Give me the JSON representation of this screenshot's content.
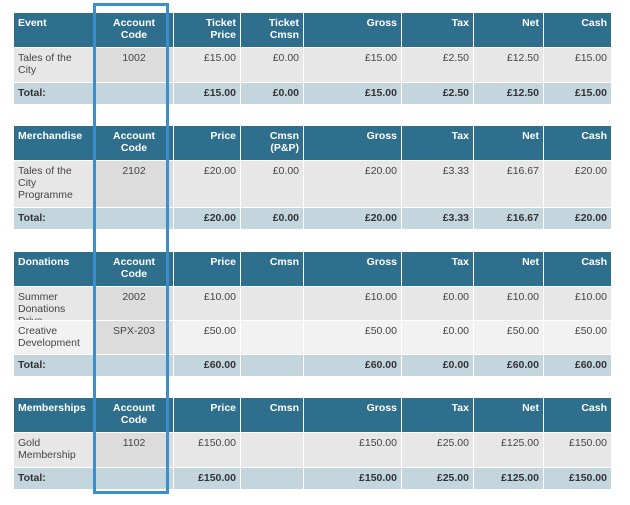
{
  "tables": [
    {
      "headers": [
        "Event",
        "Account Code",
        "Ticket Price",
        "Ticket Cmsn",
        "Gross",
        "Tax",
        "Net",
        "Cash"
      ],
      "rows": [
        [
          "Tales of the City",
          "1002",
          "£15.00",
          "£0.00",
          "£15.00",
          "£2.50",
          "£12.50",
          "£15.00"
        ]
      ],
      "total": [
        "Total:",
        "",
        "£15.00",
        "£0.00",
        "£15.00",
        "£2.50",
        "£12.50",
        "£15.00"
      ]
    },
    {
      "headers": [
        "Merchandise",
        "Account Code",
        "Price",
        "Cmsn (P&P)",
        "Gross",
        "Tax",
        "Net",
        "Cash"
      ],
      "rows": [
        [
          "Tales of the City Programme",
          "2102",
          "£20.00",
          "£0.00",
          "£20.00",
          "£3.33",
          "£16.67",
          "£20.00"
        ]
      ],
      "total": [
        "Total:",
        "",
        "£20.00",
        "£0.00",
        "£20.00",
        "£3.33",
        "£16.67",
        "£20.00"
      ]
    },
    {
      "headers": [
        "Donations",
        "Account Code",
        "Price",
        "Cmsn",
        "Gross",
        "Tax",
        "Net",
        "Cash"
      ],
      "rows": [
        [
          "Summer Donations Drive",
          "2002",
          "£10.00",
          "",
          "£10.00",
          "£0.00",
          "£10.00",
          "£10.00"
        ],
        [
          "Creative Development",
          "SPX-203",
          "£50.00",
          "",
          "£50.00",
          "£0.00",
          "£50.00",
          "£50.00"
        ]
      ],
      "total": [
        "Total:",
        "",
        "£60.00",
        "",
        "£60.00",
        "£0.00",
        "£60.00",
        "£60.00"
      ]
    },
    {
      "headers": [
        "Memberships",
        "Account Code",
        "Price",
        "Cmsn",
        "Gross",
        "Tax",
        "Net",
        "Cash"
      ],
      "rows": [
        [
          "Gold Membership",
          "1102",
          "£150.00",
          "",
          "£150.00",
          "£25.00",
          "£125.00",
          "£150.00"
        ]
      ],
      "total": [
        "Total:",
        "",
        "£150.00",
        "",
        "£150.00",
        "£25.00",
        "£125.00",
        "£150.00"
      ]
    }
  ]
}
